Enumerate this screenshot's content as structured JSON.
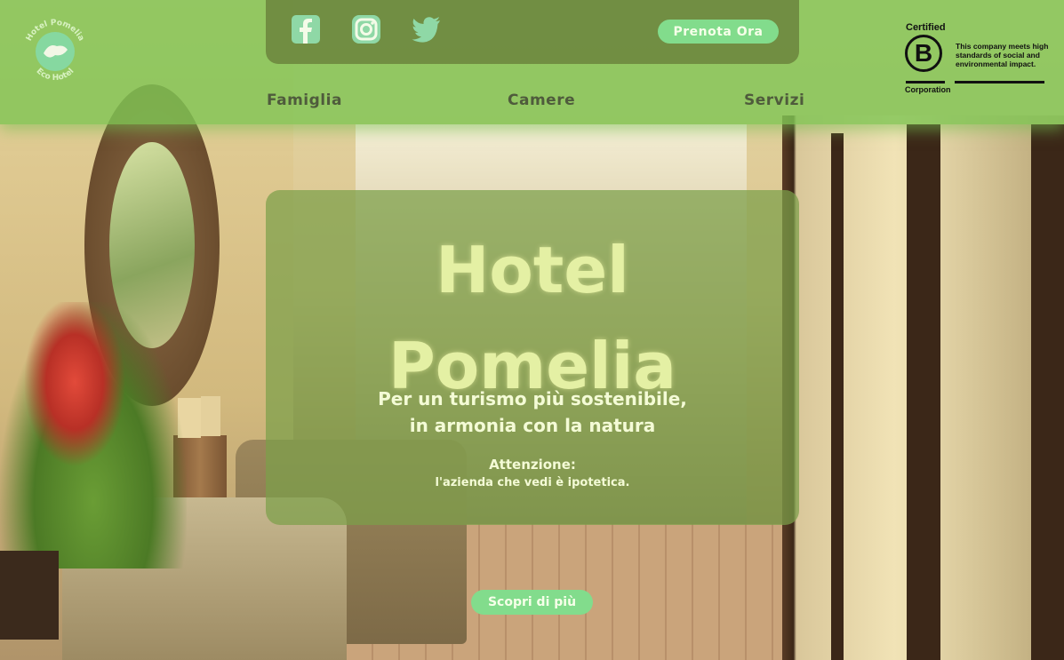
{
  "brand": {
    "logo_name": "Hotel Pomelia",
    "logo_subtitle": "Eco Hotel"
  },
  "header": {
    "social": {
      "facebook_icon": "facebook-icon",
      "instagram_icon": "instagram-icon",
      "twitter_icon": "twitter-icon"
    },
    "book_label": "Prenota Ora",
    "nav": [
      {
        "label": "Famiglia"
      },
      {
        "label": "Camere"
      },
      {
        "label": "Servizi"
      }
    ]
  },
  "bcorp": {
    "certified": "Certified",
    "letter": "B",
    "corporation": "Corporation",
    "description": "This company meets high standards of social and environmental impact."
  },
  "hero": {
    "title": "Hotel\nPomelia",
    "subtitle": "Per un turismo più sostenibile,\nin armonia con la natura",
    "note_title": "Attenzione:",
    "note": "l'azienda che vedi è ipotetica."
  },
  "cta": {
    "discover_label": "Scopri di più"
  },
  "colors": {
    "header_overlay": "#80c454",
    "button_green": "#82dc8c",
    "title_yellow": "#e4f0a4"
  }
}
